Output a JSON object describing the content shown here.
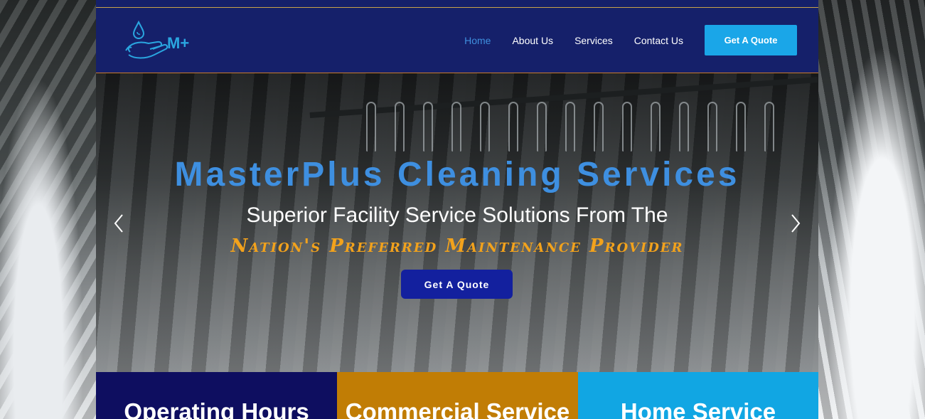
{
  "nav": {
    "logo_text": "M+",
    "items": [
      {
        "label": "Home",
        "active": true
      },
      {
        "label": "About Us",
        "active": false
      },
      {
        "label": "Services",
        "active": false
      },
      {
        "label": "Contact Us",
        "active": false
      }
    ],
    "cta_label": "Get A Quote"
  },
  "hero": {
    "title": "MasterPlus Cleaning Services",
    "subtitle": "Superior Facility Service Solutions From The",
    "tagline": "Nation's Preferred Maintenance Provider",
    "button_label": "Get A Quote"
  },
  "features": [
    {
      "label": "Operating Hours"
    },
    {
      "label": "Commercial Service"
    },
    {
      "label": "Home Service"
    }
  ],
  "colors": {
    "header_bg": "#15206a",
    "accent_blue": "#3e8fe0",
    "cta_blue": "#1aa6e8",
    "tagline_orange": "#f2a21c",
    "feature_navy": "#0e0e60",
    "feature_gold": "#c17d05",
    "feature_sky": "#11a6e3"
  }
}
